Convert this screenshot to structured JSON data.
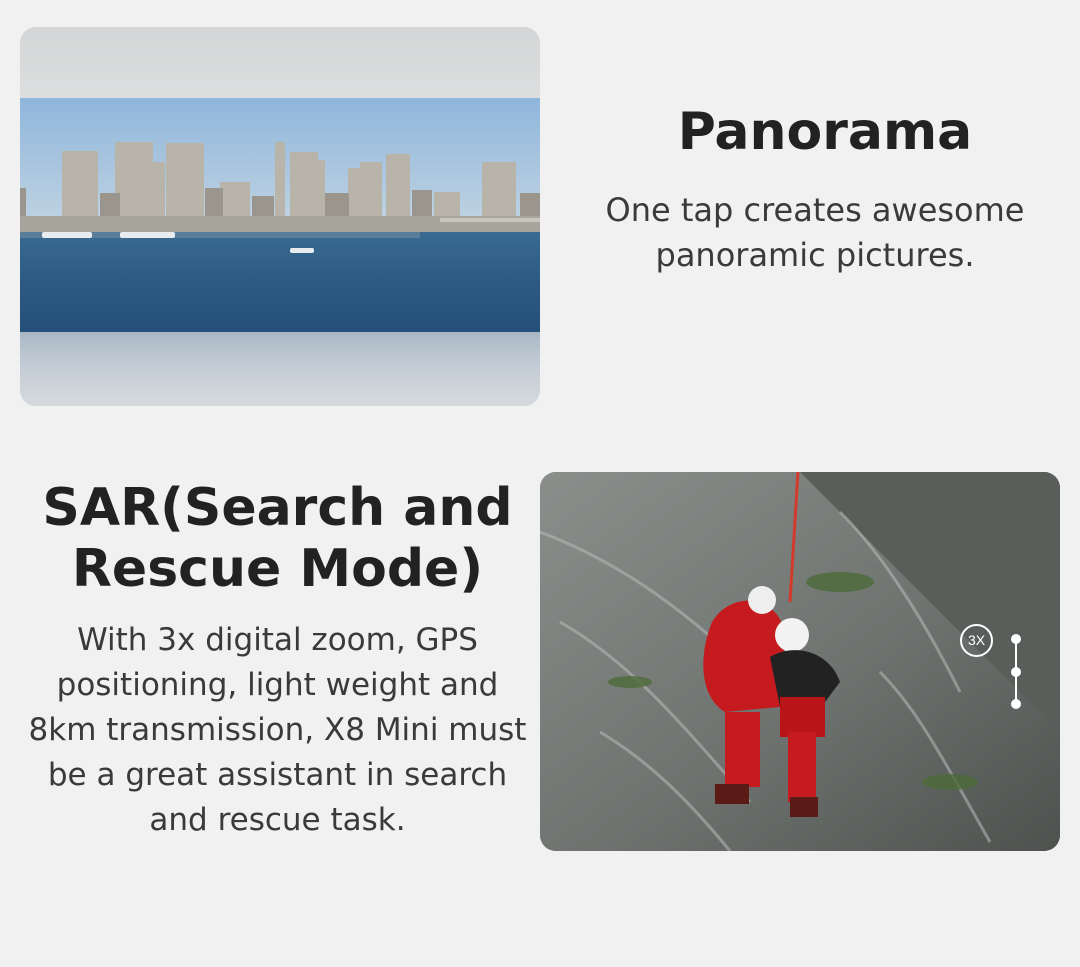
{
  "panorama": {
    "title": "Panorama",
    "description": "One tap creates awesome panoramic pictures."
  },
  "sar": {
    "title": "SAR(Search and Rescue Mode)",
    "description": "With 3x digital zoom, GPS positioning, light weight and 8km transmission, X8 Mini must be a great assistant in search and rescue task.",
    "zoom_badge": "3X"
  },
  "colors": {
    "background": "#f1f1f1",
    "heading": "#222222",
    "body_text": "#3a3a3a",
    "water": "#2f5f86",
    "sky": "#9cbede",
    "rescuer_suit": "#c9141a"
  }
}
